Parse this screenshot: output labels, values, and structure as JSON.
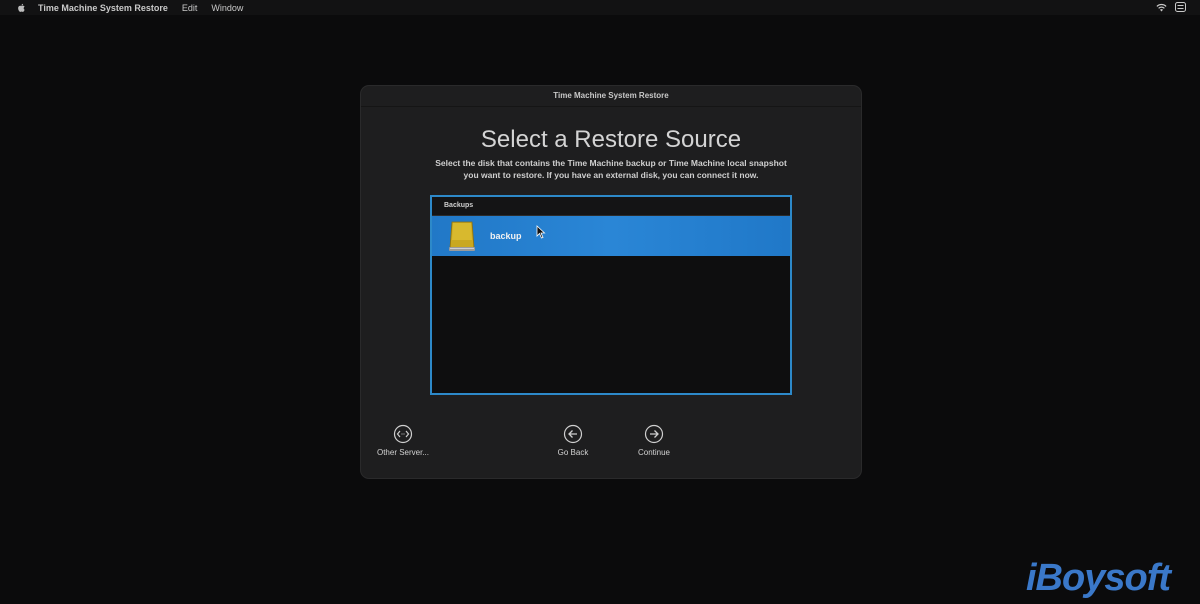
{
  "menubar": {
    "app_name": "Time Machine System Restore",
    "items": [
      "Edit",
      "Window"
    ]
  },
  "window": {
    "title": "Time Machine System Restore",
    "heading": "Select a Restore Source",
    "subtitle_line1": "Select the disk that contains the Time Machine backup or Time Machine local snapshot",
    "subtitle_line2": "you want to restore. If you have an external disk, you can connect it now."
  },
  "list": {
    "header": "Backups",
    "rows": [
      {
        "label": "backup",
        "selected": true,
        "icon": "external-disk-icon"
      }
    ]
  },
  "buttons": {
    "other_server": "Other Server...",
    "go_back": "Go Back",
    "continue": "Continue"
  },
  "watermark": "iBoysoft",
  "colors": {
    "selection": "#2a86d6",
    "list_border": "#2d89c9",
    "watermark": "#3a78c9",
    "disk": "#c9a820"
  }
}
